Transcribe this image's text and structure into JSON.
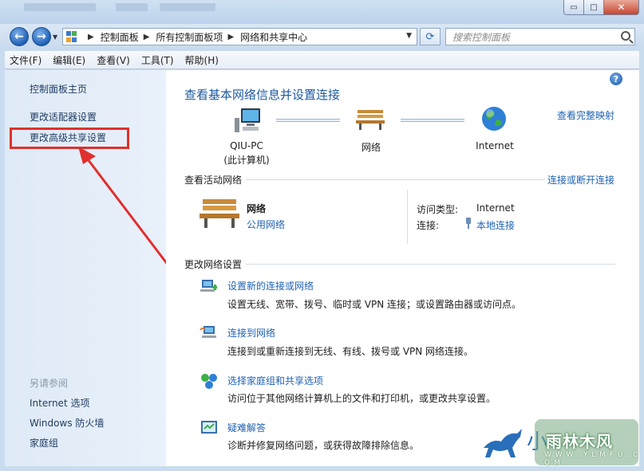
{
  "window": {
    "min_glyph": "▭",
    "max_glyph": "□",
    "close_glyph": "✕"
  },
  "address": {
    "crumbs": [
      "控制面板",
      "所有控制面板项",
      "网络和共享中心"
    ],
    "search_placeholder": "搜索控制面板"
  },
  "menu": [
    "文件(F)",
    "编辑(E)",
    "查看(V)",
    "工具(T)",
    "帮助(H)"
  ],
  "sidebar": {
    "home": "控制面板主页",
    "links": [
      "更改适配器设置",
      "更改高级共享设置"
    ],
    "see_also_heading": "另请参阅",
    "see_also": [
      "Internet 选项",
      "Windows 防火墙",
      "家庭组"
    ]
  },
  "main": {
    "heading": "查看基本网络信息并设置连接",
    "full_map": "查看完整映射",
    "nodes": [
      {
        "label": "QIU-PC",
        "sub": "(此计算机)",
        "icon": "computer-icon"
      },
      {
        "label": "网络",
        "sub": "",
        "icon": "bench-icon"
      },
      {
        "label": "Internet",
        "sub": "",
        "icon": "globe-icon"
      }
    ],
    "active_title": "查看活动网络",
    "connect_disconnect": "连接或断开连接",
    "network": {
      "name": "网络",
      "type": "公用网络",
      "access_label": "访问类型:",
      "access_value": "Internet",
      "connection_label": "连接:",
      "connection_value": "本地连接"
    },
    "change_title": "更改网络设置",
    "tasks": [
      {
        "title": "设置新的连接或网络",
        "desc": "设置无线、宽带、拨号、临时或 VPN 连接；或设置路由器或访问点。",
        "icon": "new-connection-icon"
      },
      {
        "title": "连接到网络",
        "desc": "连接到或重新连接到无线、有线、拨号或 VPN 网络连接。",
        "icon": "connect-network-icon"
      },
      {
        "title": "选择家庭组和共享选项",
        "desc": "访问位于其他网络计算机上的文件和打印机，或更改共享设置。",
        "icon": "homegroup-icon"
      },
      {
        "title": "疑难解答",
        "desc": "诊断并修复网络问题，或获得故障排除信息。",
        "icon": "troubleshoot-icon"
      }
    ]
  },
  "watermark": {
    "partial_char": "小",
    "name": "雨林木风",
    "url": "W W W . Y L M F U . C O M"
  },
  "colors": {
    "link": "#1f62b4",
    "heading": "#1e5aa0",
    "highlight": "#e0302e"
  }
}
